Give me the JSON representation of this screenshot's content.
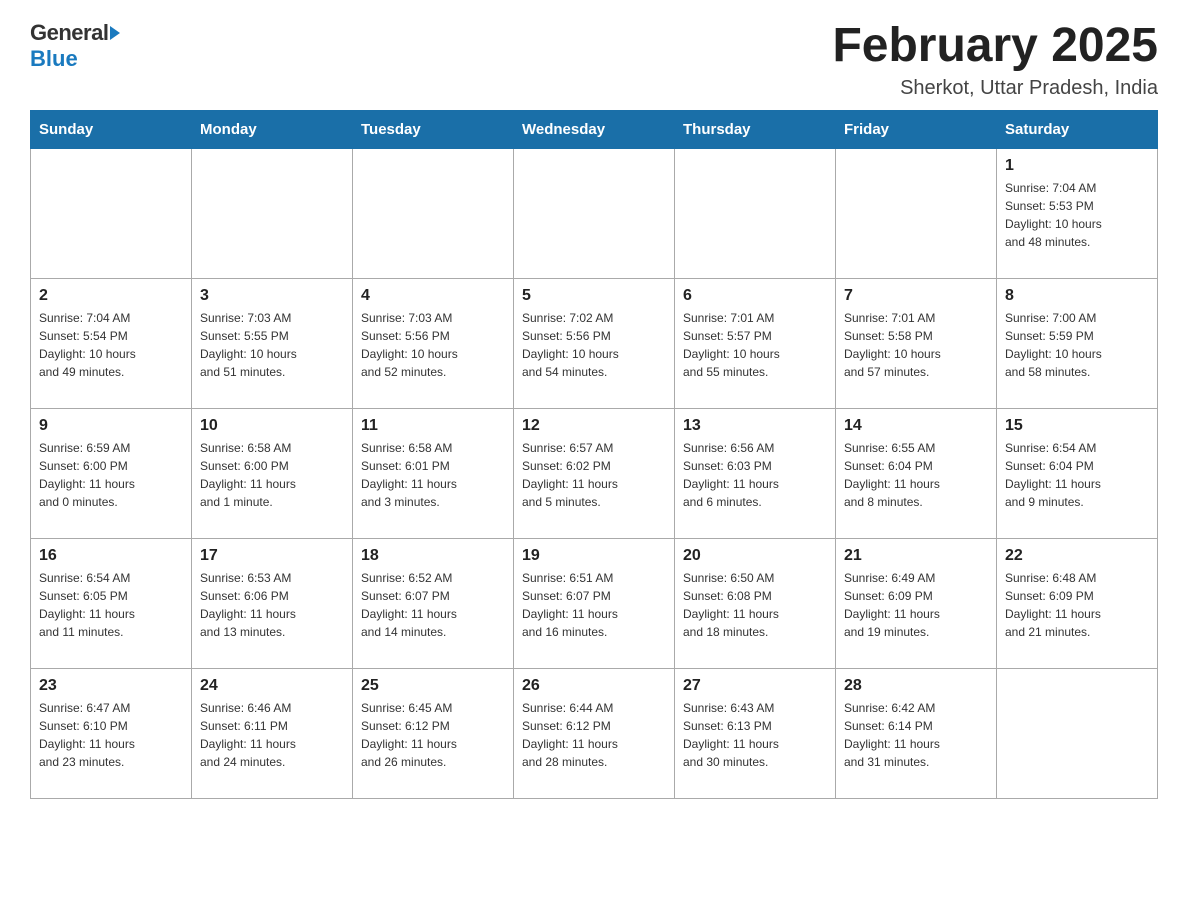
{
  "header": {
    "logo_general": "General",
    "logo_blue": "Blue",
    "month_title": "February 2025",
    "location": "Sherkot, Uttar Pradesh, India"
  },
  "weekdays": [
    "Sunday",
    "Monday",
    "Tuesday",
    "Wednesday",
    "Thursday",
    "Friday",
    "Saturday"
  ],
  "weeks": [
    [
      {
        "day": "",
        "info": ""
      },
      {
        "day": "",
        "info": ""
      },
      {
        "day": "",
        "info": ""
      },
      {
        "day": "",
        "info": ""
      },
      {
        "day": "",
        "info": ""
      },
      {
        "day": "",
        "info": ""
      },
      {
        "day": "1",
        "info": "Sunrise: 7:04 AM\nSunset: 5:53 PM\nDaylight: 10 hours\nand 48 minutes."
      }
    ],
    [
      {
        "day": "2",
        "info": "Sunrise: 7:04 AM\nSunset: 5:54 PM\nDaylight: 10 hours\nand 49 minutes."
      },
      {
        "day": "3",
        "info": "Sunrise: 7:03 AM\nSunset: 5:55 PM\nDaylight: 10 hours\nand 51 minutes."
      },
      {
        "day": "4",
        "info": "Sunrise: 7:03 AM\nSunset: 5:56 PM\nDaylight: 10 hours\nand 52 minutes."
      },
      {
        "day": "5",
        "info": "Sunrise: 7:02 AM\nSunset: 5:56 PM\nDaylight: 10 hours\nand 54 minutes."
      },
      {
        "day": "6",
        "info": "Sunrise: 7:01 AM\nSunset: 5:57 PM\nDaylight: 10 hours\nand 55 minutes."
      },
      {
        "day": "7",
        "info": "Sunrise: 7:01 AM\nSunset: 5:58 PM\nDaylight: 10 hours\nand 57 minutes."
      },
      {
        "day": "8",
        "info": "Sunrise: 7:00 AM\nSunset: 5:59 PM\nDaylight: 10 hours\nand 58 minutes."
      }
    ],
    [
      {
        "day": "9",
        "info": "Sunrise: 6:59 AM\nSunset: 6:00 PM\nDaylight: 11 hours\nand 0 minutes."
      },
      {
        "day": "10",
        "info": "Sunrise: 6:58 AM\nSunset: 6:00 PM\nDaylight: 11 hours\nand 1 minute."
      },
      {
        "day": "11",
        "info": "Sunrise: 6:58 AM\nSunset: 6:01 PM\nDaylight: 11 hours\nand 3 minutes."
      },
      {
        "day": "12",
        "info": "Sunrise: 6:57 AM\nSunset: 6:02 PM\nDaylight: 11 hours\nand 5 minutes."
      },
      {
        "day": "13",
        "info": "Sunrise: 6:56 AM\nSunset: 6:03 PM\nDaylight: 11 hours\nand 6 minutes."
      },
      {
        "day": "14",
        "info": "Sunrise: 6:55 AM\nSunset: 6:04 PM\nDaylight: 11 hours\nand 8 minutes."
      },
      {
        "day": "15",
        "info": "Sunrise: 6:54 AM\nSunset: 6:04 PM\nDaylight: 11 hours\nand 9 minutes."
      }
    ],
    [
      {
        "day": "16",
        "info": "Sunrise: 6:54 AM\nSunset: 6:05 PM\nDaylight: 11 hours\nand 11 minutes."
      },
      {
        "day": "17",
        "info": "Sunrise: 6:53 AM\nSunset: 6:06 PM\nDaylight: 11 hours\nand 13 minutes."
      },
      {
        "day": "18",
        "info": "Sunrise: 6:52 AM\nSunset: 6:07 PM\nDaylight: 11 hours\nand 14 minutes."
      },
      {
        "day": "19",
        "info": "Sunrise: 6:51 AM\nSunset: 6:07 PM\nDaylight: 11 hours\nand 16 minutes."
      },
      {
        "day": "20",
        "info": "Sunrise: 6:50 AM\nSunset: 6:08 PM\nDaylight: 11 hours\nand 18 minutes."
      },
      {
        "day": "21",
        "info": "Sunrise: 6:49 AM\nSunset: 6:09 PM\nDaylight: 11 hours\nand 19 minutes."
      },
      {
        "day": "22",
        "info": "Sunrise: 6:48 AM\nSunset: 6:09 PM\nDaylight: 11 hours\nand 21 minutes."
      }
    ],
    [
      {
        "day": "23",
        "info": "Sunrise: 6:47 AM\nSunset: 6:10 PM\nDaylight: 11 hours\nand 23 minutes."
      },
      {
        "day": "24",
        "info": "Sunrise: 6:46 AM\nSunset: 6:11 PM\nDaylight: 11 hours\nand 24 minutes."
      },
      {
        "day": "25",
        "info": "Sunrise: 6:45 AM\nSunset: 6:12 PM\nDaylight: 11 hours\nand 26 minutes."
      },
      {
        "day": "26",
        "info": "Sunrise: 6:44 AM\nSunset: 6:12 PM\nDaylight: 11 hours\nand 28 minutes."
      },
      {
        "day": "27",
        "info": "Sunrise: 6:43 AM\nSunset: 6:13 PM\nDaylight: 11 hours\nand 30 minutes."
      },
      {
        "day": "28",
        "info": "Sunrise: 6:42 AM\nSunset: 6:14 PM\nDaylight: 11 hours\nand 31 minutes."
      },
      {
        "day": "",
        "info": ""
      }
    ]
  ]
}
